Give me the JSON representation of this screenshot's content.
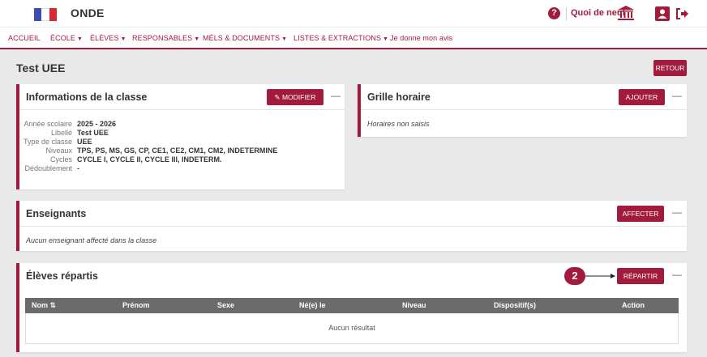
{
  "header": {
    "app_title": "ONDE",
    "help_icon": "question-icon",
    "quoi_de_neuf": "Quoi de neuf",
    "bank_icon": "building-icon",
    "user_icon": "user-icon",
    "logout_icon": "logout-icon"
  },
  "nav": [
    {
      "label": "ACCUEIL",
      "dropdown": false
    },
    {
      "label": "ÉCOLE",
      "dropdown": true
    },
    {
      "label": "ÉLÈVES",
      "dropdown": true
    },
    {
      "label": "RESPONSABLES",
      "dropdown": true
    },
    {
      "label": "MÉLS & DOCUMENTS",
      "dropdown": true
    },
    {
      "label": "LISTES & EXTRACTIONS",
      "dropdown": true
    },
    {
      "label": "Je donne mon avis",
      "dropdown": false
    }
  ],
  "page": {
    "title": "Test UEE",
    "retour": "RETOUR"
  },
  "info_panel": {
    "title": "Informations de la classe",
    "modifier": "MODIFIER",
    "collapse": "—",
    "rows": [
      {
        "label": "Année scolaire",
        "value": "2025 - 2026"
      },
      {
        "label": "Libellé",
        "value": "Test UEE"
      },
      {
        "label": "Type de classe",
        "value": "UEE"
      },
      {
        "label": "Niveaux",
        "value": "TPS, PS, MS, GS, CP, CE1, CE2, CM1, CM2, INDETERMINE"
      },
      {
        "label": "Cycles",
        "value": "CYCLE I, CYCLE II, CYCLE III, INDETERM."
      },
      {
        "label": "Dédoublement",
        "value": "-"
      }
    ]
  },
  "grille_panel": {
    "title": "Grille horaire",
    "ajouter": "AJOUTER",
    "collapse": "—",
    "empty": "Horaires non saisis"
  },
  "enseignants_panel": {
    "title": "Enseignants",
    "affecter": "AFFECTER",
    "collapse": "—",
    "empty": "Aucun enseignant affecté dans la classe"
  },
  "eleves_panel": {
    "title": "Élèves répartis",
    "badge": "2",
    "repartir": "RÉPARTIR",
    "collapse": "—",
    "columns": [
      "Nom",
      "Prénom",
      "Sexe",
      "Né(e) le",
      "Niveau",
      "Dispositif(s)",
      "Action"
    ],
    "empty": "Aucun résultat"
  },
  "colors": {
    "accent": "#a21b3c",
    "table_header": "#6b6b6b",
    "background": "#e9e9ea"
  }
}
